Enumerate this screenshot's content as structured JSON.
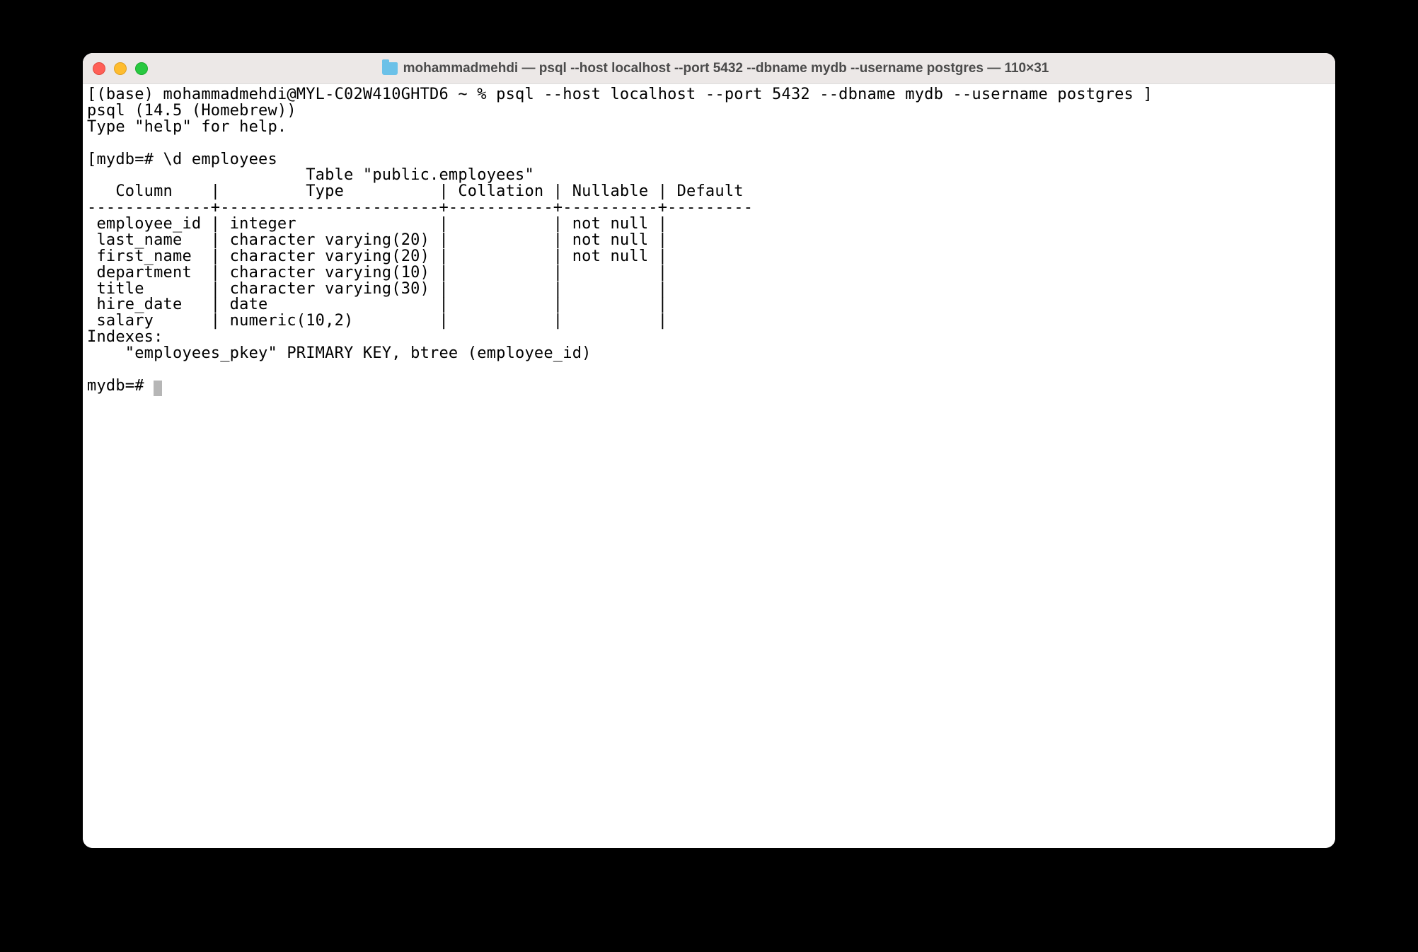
{
  "window": {
    "title": "mohammadmehdi — psql --host localhost --port 5432 --dbname mydb --username postgres — 110×31"
  },
  "terminal": {
    "line1": "[(base) mohammadmehdi@MYL-C02W410GHTD6 ~ % psql --host localhost --port 5432 --dbname mydb --username postgres ]",
    "line2": "psql (14.5 (Homebrew))",
    "line3": "Type \"help\" for help.",
    "line4": "",
    "line5": "[mydb=# \\d employees",
    "line6": "                       Table \"public.employees\"",
    "line7": "   Column    |         Type          | Collation | Nullable | Default ",
    "line8": "-------------+-----------------------+-----------+----------+---------",
    "line9": " employee_id | integer               |           | not null | ",
    "line10": " last_name   | character varying(20) |           | not null | ",
    "line11": " first_name  | character varying(20) |           | not null | ",
    "line12": " department  | character varying(10) |           |          | ",
    "line13": " title       | character varying(30) |           |          | ",
    "line14": " hire_date   | date                  |           |          | ",
    "line15": " salary      | numeric(10,2)         |           |          | ",
    "line16": "Indexes:",
    "line17": "    \"employees_pkey\" PRIMARY KEY, btree (employee_id)",
    "line18": "",
    "line19": "mydb=# "
  }
}
